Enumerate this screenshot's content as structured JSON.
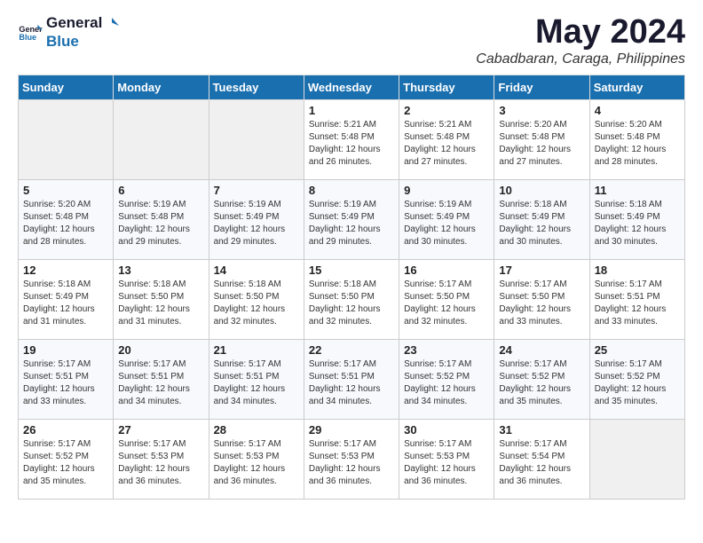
{
  "header": {
    "logo_general": "General",
    "logo_blue": "Blue",
    "month_title": "May 2024",
    "subtitle": "Cabadbaran, Caraga, Philippines"
  },
  "weekdays": [
    "Sunday",
    "Monday",
    "Tuesday",
    "Wednesday",
    "Thursday",
    "Friday",
    "Saturday"
  ],
  "weeks": [
    [
      {
        "day": "",
        "content": ""
      },
      {
        "day": "",
        "content": ""
      },
      {
        "day": "",
        "content": ""
      },
      {
        "day": "1",
        "content": "Sunrise: 5:21 AM\nSunset: 5:48 PM\nDaylight: 12 hours\nand 26 minutes."
      },
      {
        "day": "2",
        "content": "Sunrise: 5:21 AM\nSunset: 5:48 PM\nDaylight: 12 hours\nand 27 minutes."
      },
      {
        "day": "3",
        "content": "Sunrise: 5:20 AM\nSunset: 5:48 PM\nDaylight: 12 hours\nand 27 minutes."
      },
      {
        "day": "4",
        "content": "Sunrise: 5:20 AM\nSunset: 5:48 PM\nDaylight: 12 hours\nand 28 minutes."
      }
    ],
    [
      {
        "day": "5",
        "content": "Sunrise: 5:20 AM\nSunset: 5:48 PM\nDaylight: 12 hours\nand 28 minutes."
      },
      {
        "day": "6",
        "content": "Sunrise: 5:19 AM\nSunset: 5:48 PM\nDaylight: 12 hours\nand 29 minutes."
      },
      {
        "day": "7",
        "content": "Sunrise: 5:19 AM\nSunset: 5:49 PM\nDaylight: 12 hours\nand 29 minutes."
      },
      {
        "day": "8",
        "content": "Sunrise: 5:19 AM\nSunset: 5:49 PM\nDaylight: 12 hours\nand 29 minutes."
      },
      {
        "day": "9",
        "content": "Sunrise: 5:19 AM\nSunset: 5:49 PM\nDaylight: 12 hours\nand 30 minutes."
      },
      {
        "day": "10",
        "content": "Sunrise: 5:18 AM\nSunset: 5:49 PM\nDaylight: 12 hours\nand 30 minutes."
      },
      {
        "day": "11",
        "content": "Sunrise: 5:18 AM\nSunset: 5:49 PM\nDaylight: 12 hours\nand 30 minutes."
      }
    ],
    [
      {
        "day": "12",
        "content": "Sunrise: 5:18 AM\nSunset: 5:49 PM\nDaylight: 12 hours\nand 31 minutes."
      },
      {
        "day": "13",
        "content": "Sunrise: 5:18 AM\nSunset: 5:50 PM\nDaylight: 12 hours\nand 31 minutes."
      },
      {
        "day": "14",
        "content": "Sunrise: 5:18 AM\nSunset: 5:50 PM\nDaylight: 12 hours\nand 32 minutes."
      },
      {
        "day": "15",
        "content": "Sunrise: 5:18 AM\nSunset: 5:50 PM\nDaylight: 12 hours\nand 32 minutes."
      },
      {
        "day": "16",
        "content": "Sunrise: 5:17 AM\nSunset: 5:50 PM\nDaylight: 12 hours\nand 32 minutes."
      },
      {
        "day": "17",
        "content": "Sunrise: 5:17 AM\nSunset: 5:50 PM\nDaylight: 12 hours\nand 33 minutes."
      },
      {
        "day": "18",
        "content": "Sunrise: 5:17 AM\nSunset: 5:51 PM\nDaylight: 12 hours\nand 33 minutes."
      }
    ],
    [
      {
        "day": "19",
        "content": "Sunrise: 5:17 AM\nSunset: 5:51 PM\nDaylight: 12 hours\nand 33 minutes."
      },
      {
        "day": "20",
        "content": "Sunrise: 5:17 AM\nSunset: 5:51 PM\nDaylight: 12 hours\nand 34 minutes."
      },
      {
        "day": "21",
        "content": "Sunrise: 5:17 AM\nSunset: 5:51 PM\nDaylight: 12 hours\nand 34 minutes."
      },
      {
        "day": "22",
        "content": "Sunrise: 5:17 AM\nSunset: 5:51 PM\nDaylight: 12 hours\nand 34 minutes."
      },
      {
        "day": "23",
        "content": "Sunrise: 5:17 AM\nSunset: 5:52 PM\nDaylight: 12 hours\nand 34 minutes."
      },
      {
        "day": "24",
        "content": "Sunrise: 5:17 AM\nSunset: 5:52 PM\nDaylight: 12 hours\nand 35 minutes."
      },
      {
        "day": "25",
        "content": "Sunrise: 5:17 AM\nSunset: 5:52 PM\nDaylight: 12 hours\nand 35 minutes."
      }
    ],
    [
      {
        "day": "26",
        "content": "Sunrise: 5:17 AM\nSunset: 5:52 PM\nDaylight: 12 hours\nand 35 minutes."
      },
      {
        "day": "27",
        "content": "Sunrise: 5:17 AM\nSunset: 5:53 PM\nDaylight: 12 hours\nand 36 minutes."
      },
      {
        "day": "28",
        "content": "Sunrise: 5:17 AM\nSunset: 5:53 PM\nDaylight: 12 hours\nand 36 minutes."
      },
      {
        "day": "29",
        "content": "Sunrise: 5:17 AM\nSunset: 5:53 PM\nDaylight: 12 hours\nand 36 minutes."
      },
      {
        "day": "30",
        "content": "Sunrise: 5:17 AM\nSunset: 5:53 PM\nDaylight: 12 hours\nand 36 minutes."
      },
      {
        "day": "31",
        "content": "Sunrise: 5:17 AM\nSunset: 5:54 PM\nDaylight: 12 hours\nand 36 minutes."
      },
      {
        "day": "",
        "content": ""
      }
    ]
  ]
}
